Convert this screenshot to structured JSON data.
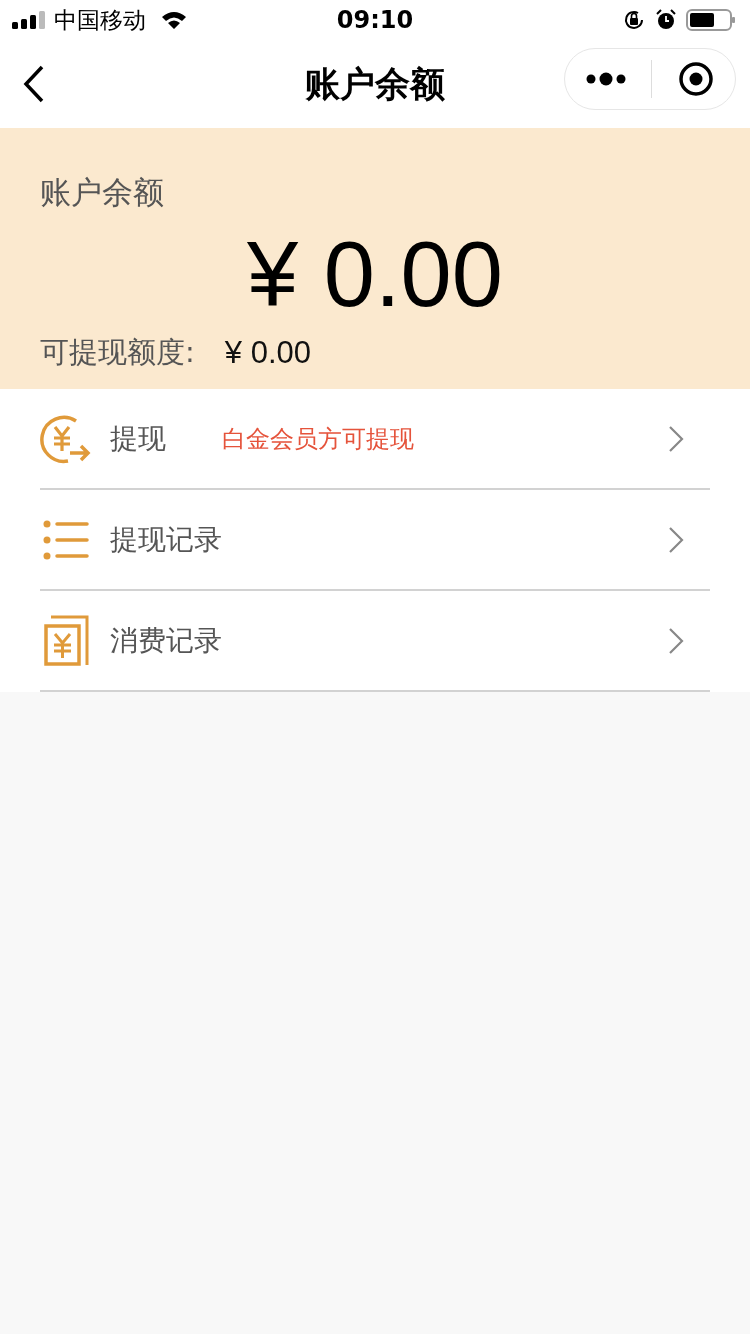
{
  "status_bar": {
    "carrier": "中国移动",
    "time": "09:10"
  },
  "nav": {
    "title": "账户余额"
  },
  "balance": {
    "label": "账户余额",
    "amount": "¥ 0.00",
    "withdrawable_label": "可提现额度:",
    "withdrawable_amount": "¥ 0.00"
  },
  "menu": [
    {
      "kind": "withdraw",
      "label": "提现",
      "note": "白金会员方可提现"
    },
    {
      "kind": "list",
      "label": "提现记录"
    },
    {
      "kind": "receipt",
      "label": "消费记录"
    }
  ]
}
